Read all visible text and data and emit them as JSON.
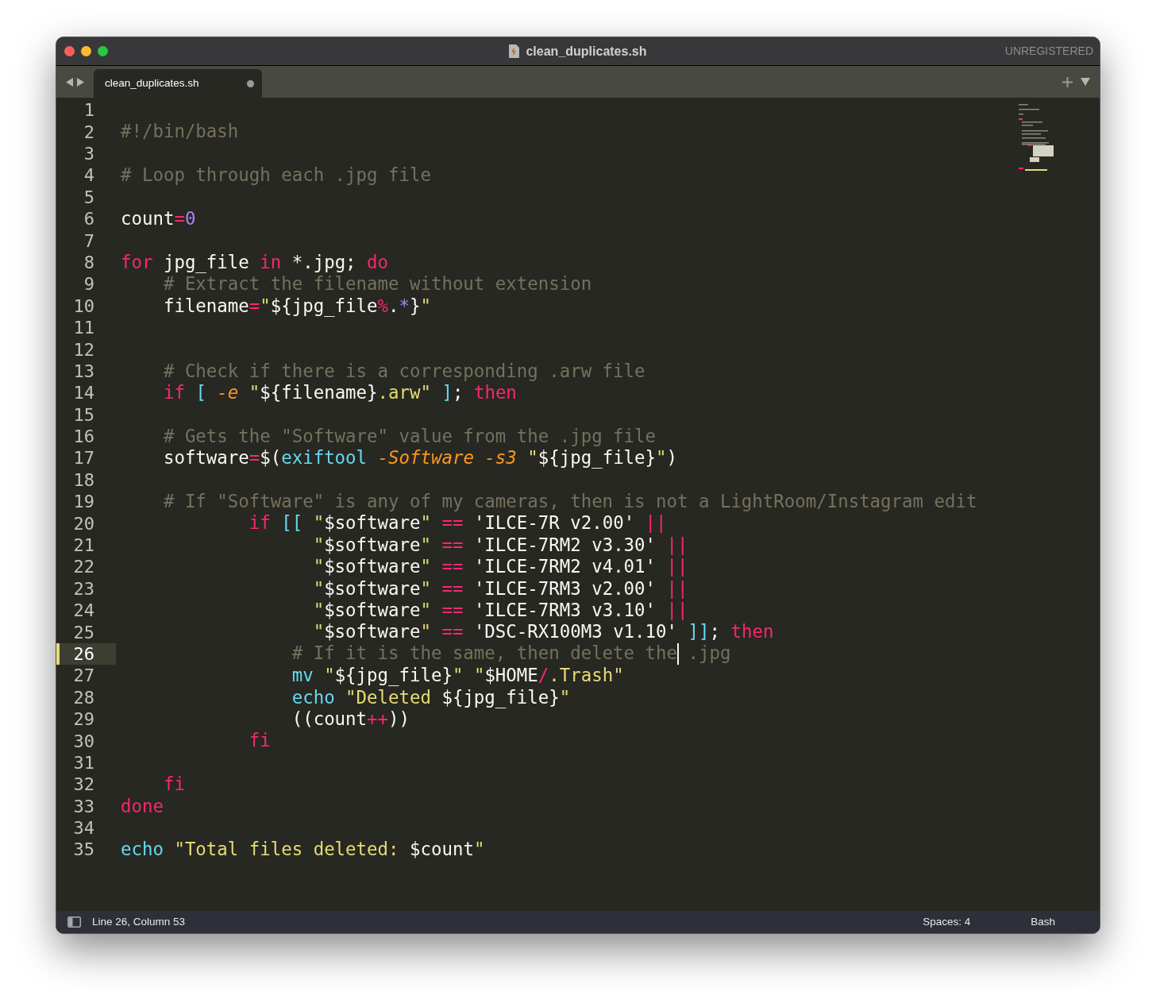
{
  "window": {
    "title": "clean_duplicates.sh",
    "badge": "UNREGISTERED"
  },
  "tabs": [
    {
      "label": "clean_duplicates.sh",
      "selected": true,
      "modified": true
    }
  ],
  "editor": {
    "lines": [
      {
        "number": "1",
        "current": false
      },
      {
        "number": "2",
        "current": false,
        "tokens": [
          {
            "text": "#!/bin/bash",
            "kind": "comment"
          }
        ]
      },
      {
        "number": "3",
        "current": false
      },
      {
        "number": "4",
        "current": false,
        "tokens": [
          {
            "text": "# Loop through each .jpg file",
            "kind": "comment"
          }
        ]
      },
      {
        "number": "5",
        "current": false
      },
      {
        "number": "6",
        "current": false,
        "tokens": [
          {
            "text": "count",
            "kind": "plain"
          },
          {
            "text": "=",
            "kind": "operator"
          },
          {
            "text": "0",
            "kind": "number"
          }
        ]
      },
      {
        "number": "7",
        "current": false
      },
      {
        "number": "8",
        "current": false,
        "tokens": [
          {
            "text": "for",
            "kind": "keyword"
          },
          {
            "text": " jpg_file ",
            "kind": "plain"
          },
          {
            "text": "in",
            "kind": "keyword"
          },
          {
            "text": " *.jpg; ",
            "kind": "plain"
          },
          {
            "text": "do",
            "kind": "keyword"
          }
        ]
      },
      {
        "number": "9",
        "current": false,
        "tokens": [
          {
            "text": "    # Extract the filename without extension",
            "kind": "comment"
          }
        ]
      },
      {
        "number": "10",
        "current": false,
        "tokens": [
          {
            "text": "    filename",
            "kind": "plain"
          },
          {
            "text": "=",
            "kind": "operator"
          },
          {
            "text": "\"",
            "kind": "string"
          },
          {
            "text": "${jpg_file",
            "kind": "plain"
          },
          {
            "text": "%",
            "kind": "operator"
          },
          {
            "text": ".",
            "kind": "plain"
          },
          {
            "text": "*",
            "kind": "number"
          },
          {
            "text": "}",
            "kind": "plain"
          },
          {
            "text": "\"",
            "kind": "string"
          }
        ]
      },
      {
        "number": "11",
        "current": false
      },
      {
        "number": "12",
        "current": false
      },
      {
        "number": "13",
        "current": false,
        "tokens": [
          {
            "text": "    # Check if there is a corresponding .arw file",
            "kind": "comment"
          }
        ]
      },
      {
        "number": "14",
        "current": false,
        "tokens": [
          {
            "text": "    if ",
            "kind": "keyword"
          },
          {
            "text": "[ ",
            "kind": "builtin"
          },
          {
            "text": "-e ",
            "kind": "param"
          },
          {
            "text": "\"",
            "kind": "string"
          },
          {
            "text": "${filename}",
            "kind": "plain"
          },
          {
            "text": ".arw\" ",
            "kind": "string"
          },
          {
            "text": "]",
            "kind": "builtin"
          },
          {
            "text": "; ",
            "kind": "plain"
          },
          {
            "text": "then",
            "kind": "keyword"
          }
        ]
      },
      {
        "number": "15",
        "current": false
      },
      {
        "number": "16",
        "current": false,
        "tokens": [
          {
            "text": "    # Gets the \"Software\" value from the .jpg file",
            "kind": "comment"
          }
        ]
      },
      {
        "number": "17",
        "current": false,
        "tokens": [
          {
            "text": "    software",
            "kind": "plain"
          },
          {
            "text": "=",
            "kind": "operator"
          },
          {
            "text": "$(",
            "kind": "plain"
          },
          {
            "text": "exiftool ",
            "kind": "builtin"
          },
          {
            "text": "-Software -s3 ",
            "kind": "param"
          },
          {
            "text": "\"",
            "kind": "string"
          },
          {
            "text": "${jpg_file}",
            "kind": "plain"
          },
          {
            "text": "\"",
            "kind": "string"
          },
          {
            "text": ")",
            "kind": "plain"
          }
        ]
      },
      {
        "number": "18",
        "current": false
      },
      {
        "number": "19",
        "current": false,
        "tokens": [
          {
            "text": "    # If \"Software\" is any of my cameras, then is not a LightRoom/Instagram edit",
            "kind": "comment"
          }
        ]
      },
      {
        "number": "20",
        "current": false,
        "tokens": [
          {
            "text": "            if ",
            "kind": "keyword"
          },
          {
            "text": "[[ ",
            "kind": "builtin"
          },
          {
            "text": "\"",
            "kind": "string"
          },
          {
            "text": "$software",
            "kind": "plain"
          },
          {
            "text": "\" ",
            "kind": "string"
          },
          {
            "text": "==",
            "kind": "operator"
          },
          {
            "text": " 'ILCE-7R v2.00' ",
            "kind": "plain"
          },
          {
            "text": "||",
            "kind": "operator"
          }
        ]
      },
      {
        "number": "21",
        "current": false,
        "tokens": [
          {
            "text": "                  \"",
            "kind": "string"
          },
          {
            "text": "$software",
            "kind": "plain"
          },
          {
            "text": "\" ",
            "kind": "string"
          },
          {
            "text": "==",
            "kind": "operator"
          },
          {
            "text": " 'ILCE-7RM2 v3.30' ",
            "kind": "plain"
          },
          {
            "text": "||",
            "kind": "operator"
          }
        ]
      },
      {
        "number": "22",
        "current": false,
        "tokens": [
          {
            "text": "                  \"",
            "kind": "string"
          },
          {
            "text": "$software",
            "kind": "plain"
          },
          {
            "text": "\" ",
            "kind": "string"
          },
          {
            "text": "==",
            "kind": "operator"
          },
          {
            "text": " 'ILCE-7RM2 v4.01' ",
            "kind": "plain"
          },
          {
            "text": "||",
            "kind": "operator"
          }
        ]
      },
      {
        "number": "23",
        "current": false,
        "tokens": [
          {
            "text": "                  \"",
            "kind": "string"
          },
          {
            "text": "$software",
            "kind": "plain"
          },
          {
            "text": "\" ",
            "kind": "string"
          },
          {
            "text": "==",
            "kind": "operator"
          },
          {
            "text": " 'ILCE-7RM3 v2.00' ",
            "kind": "plain"
          },
          {
            "text": "||",
            "kind": "operator"
          }
        ]
      },
      {
        "number": "24",
        "current": false,
        "tokens": [
          {
            "text": "                  \"",
            "kind": "string"
          },
          {
            "text": "$software",
            "kind": "plain"
          },
          {
            "text": "\" ",
            "kind": "string"
          },
          {
            "text": "==",
            "kind": "operator"
          },
          {
            "text": " 'ILCE-7RM3 v3.10' ",
            "kind": "plain"
          },
          {
            "text": "||",
            "kind": "operator"
          }
        ]
      },
      {
        "number": "25",
        "current": false,
        "tokens": [
          {
            "text": "                  \"",
            "kind": "string"
          },
          {
            "text": "$software",
            "kind": "plain"
          },
          {
            "text": "\" ",
            "kind": "string"
          },
          {
            "text": "==",
            "kind": "operator"
          },
          {
            "text": " 'DSC-RX100M3 v1.10' ",
            "kind": "plain"
          },
          {
            "text": "]]",
            "kind": "builtin"
          },
          {
            "text": "; ",
            "kind": "plain"
          },
          {
            "text": "then",
            "kind": "keyword"
          }
        ]
      },
      {
        "number": "26",
        "current": true,
        "tokens": [
          {
            "text": "                # If it is the same, then delete the",
            "kind": "comment"
          },
          {
            "kind": "caret"
          },
          {
            "text": " .jpg",
            "kind": "comment"
          }
        ]
      },
      {
        "number": "27",
        "current": false,
        "tokens": [
          {
            "text": "                mv ",
            "kind": "builtin"
          },
          {
            "text": "\"",
            "kind": "string"
          },
          {
            "text": "${jpg_file}",
            "kind": "plain"
          },
          {
            "text": "\" \"",
            "kind": "string"
          },
          {
            "text": "$HOME",
            "kind": "plain"
          },
          {
            "text": "/",
            "kind": "operator"
          },
          {
            "text": ".Trash\"",
            "kind": "string"
          }
        ]
      },
      {
        "number": "28",
        "current": false,
        "tokens": [
          {
            "text": "                echo ",
            "kind": "builtin"
          },
          {
            "text": "\"Deleted ",
            "kind": "string"
          },
          {
            "text": "${jpg_file}",
            "kind": "plain"
          },
          {
            "text": "\"",
            "kind": "string"
          }
        ]
      },
      {
        "number": "29",
        "current": false,
        "tokens": [
          {
            "text": "                ((count",
            "kind": "plain"
          },
          {
            "text": "++",
            "kind": "operator"
          },
          {
            "text": "))",
            "kind": "plain"
          }
        ]
      },
      {
        "number": "30",
        "current": false,
        "tokens": [
          {
            "text": "            fi",
            "kind": "keyword"
          }
        ]
      },
      {
        "number": "31",
        "current": false
      },
      {
        "number": "32",
        "current": false,
        "tokens": [
          {
            "text": "    fi",
            "kind": "keyword"
          }
        ]
      },
      {
        "number": "33",
        "current": false,
        "tokens": [
          {
            "text": "done",
            "kind": "keyword"
          }
        ]
      },
      {
        "number": "34",
        "current": false
      },
      {
        "number": "35",
        "current": false,
        "tokens": [
          {
            "text": "echo ",
            "kind": "builtin"
          },
          {
            "text": "\"Total files deleted: ",
            "kind": "string"
          },
          {
            "text": "$count",
            "kind": "plain"
          },
          {
            "text": "\"",
            "kind": "string"
          }
        ]
      }
    ]
  },
  "status_bar": {
    "position": "Line 26, Column 53",
    "indentation": "Spaces: 4",
    "syntax": "Bash"
  }
}
